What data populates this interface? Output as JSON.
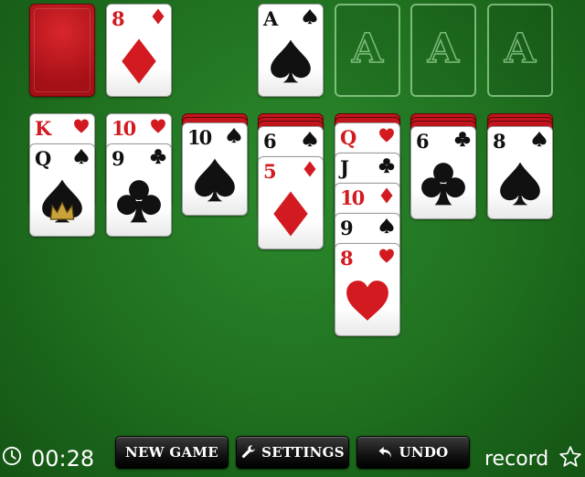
{
  "stock": {
    "count_visible": 1
  },
  "waste": {
    "top": {
      "rank": "8",
      "suit": "diamonds",
      "color": "red"
    }
  },
  "foundations": [
    {
      "top": {
        "rank": "A",
        "suit": "spades",
        "color": "black"
      }
    },
    {
      "empty_label": "A"
    },
    {
      "empty_label": "A"
    },
    {
      "empty_label": "A"
    }
  ],
  "tableau": [
    {
      "hidden": 0,
      "cards": [
        {
          "rank": "K",
          "suit": "hearts",
          "color": "red"
        },
        {
          "rank": "Q",
          "suit": "spades",
          "color": "black"
        }
      ]
    },
    {
      "hidden": 0,
      "cards": [
        {
          "rank": "10",
          "suit": "hearts",
          "color": "red"
        },
        {
          "rank": "9",
          "suit": "clubs",
          "color": "black"
        }
      ]
    },
    {
      "hidden": 2,
      "cards": [
        {
          "rank": "10",
          "suit": "spades",
          "color": "black"
        }
      ]
    },
    {
      "hidden": 3,
      "cards": [
        {
          "rank": "6",
          "suit": "spades",
          "color": "black"
        },
        {
          "rank": "5",
          "suit": "diamonds",
          "color": "red"
        }
      ]
    },
    {
      "hidden": 2,
      "cards": [
        {
          "rank": "Q",
          "suit": "hearts",
          "color": "red"
        },
        {
          "rank": "J",
          "suit": "clubs",
          "color": "black"
        },
        {
          "rank": "10",
          "suit": "diamonds",
          "color": "red"
        },
        {
          "rank": "9",
          "suit": "spades",
          "color": "black"
        },
        {
          "rank": "8",
          "suit": "hearts",
          "color": "red"
        }
      ]
    },
    {
      "hidden": 3,
      "cards": [
        {
          "rank": "6",
          "suit": "clubs",
          "color": "black"
        }
      ]
    },
    {
      "hidden": 3,
      "cards": [
        {
          "rank": "8",
          "suit": "spades",
          "color": "black"
        }
      ]
    }
  ],
  "toolbar": {
    "timer": "00:28",
    "new_game_label": "NEW GAME",
    "settings_label": "SETTINGS",
    "undo_label": "UNDO",
    "record_label": "record"
  },
  "colors": {
    "felt": "#1f6f1f",
    "card_red": "#d31a20",
    "card_back": "#c3151d"
  }
}
